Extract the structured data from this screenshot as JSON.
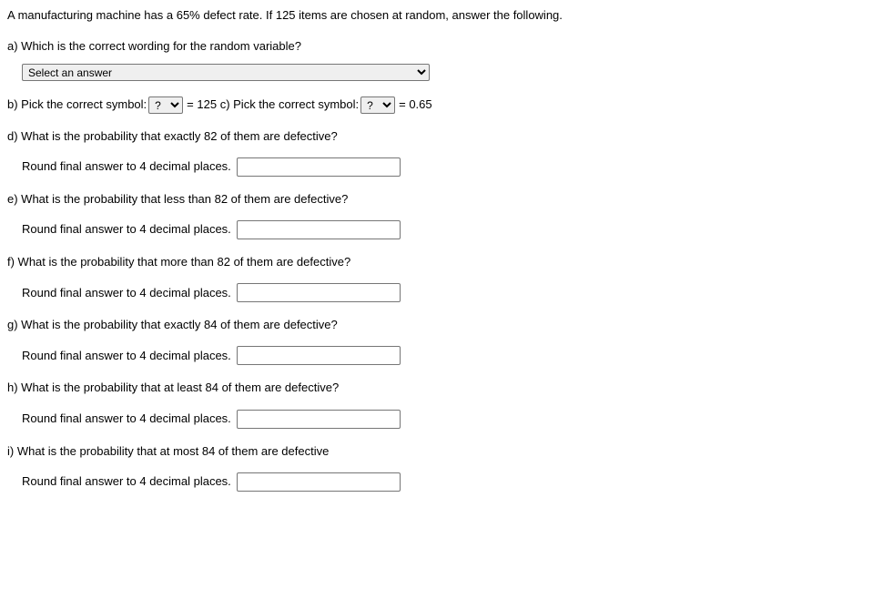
{
  "intro": "A manufacturing machine has a 65% defect rate. If 125 items are chosen at random, answer the following.",
  "parts": {
    "a": {
      "prompt": "a) Which is the correct wording for the random variable?",
      "select_placeholder": "Select an answer"
    },
    "b": {
      "prompt_prefix": "b) Pick the correct symbol:",
      "select_placeholder": "?",
      "suffix": "= 125"
    },
    "c": {
      "prompt_prefix": "c) Pick the correct symbol:",
      "select_placeholder": "?",
      "suffix": "= 0.65"
    },
    "d": {
      "prompt": "d) What is the probability that exactly 82 of them are defective?",
      "instruction": "Round final answer to 4 decimal places."
    },
    "e": {
      "prompt": "e) What is the probability that less than 82 of them are defective?",
      "instruction": "Round final answer to 4 decimal places."
    },
    "f": {
      "prompt": "f) What is the probability that more than 82 of them are defective?",
      "instruction": "Round final answer to 4 decimal places."
    },
    "g": {
      "prompt": "g) What is the probability that exactly 84 of them are defective?",
      "instruction": "Round final answer to 4 decimal places."
    },
    "h": {
      "prompt": "h) What is the probability that at least 84 of them are defective?",
      "instruction": "Round final answer to 4 decimal places."
    },
    "i": {
      "prompt": "i) What is the probability that at most 84 of them are defective",
      "instruction": "Round final answer to 4 decimal places."
    }
  }
}
